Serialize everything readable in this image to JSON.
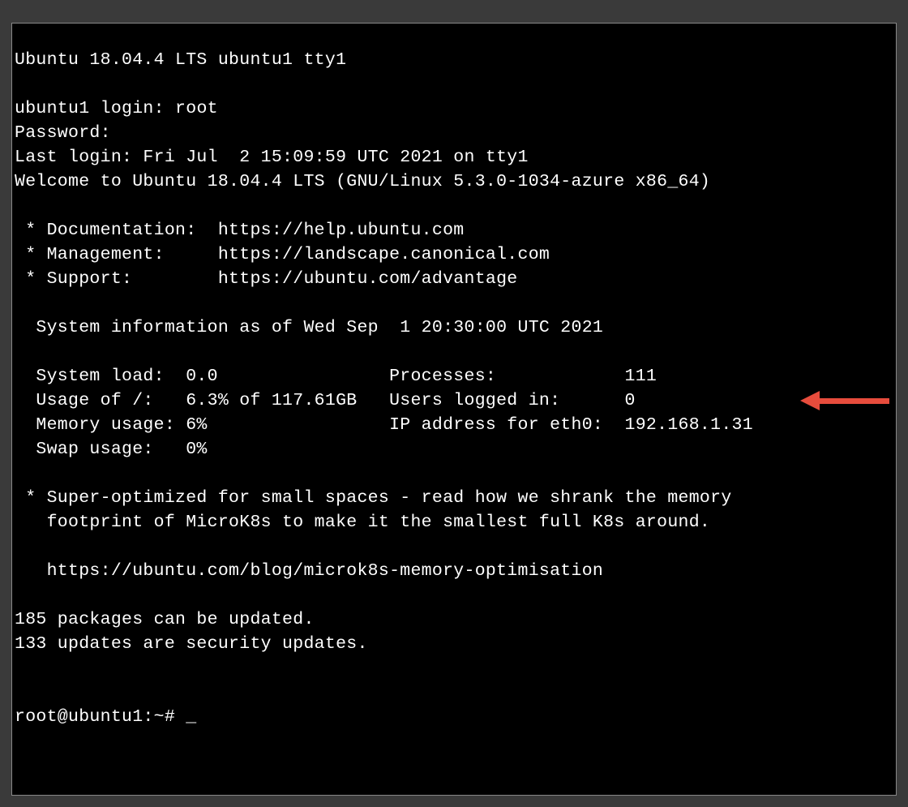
{
  "banner": "Ubuntu 18.04.4 LTS ubuntu1 tty1",
  "login_prompt": "ubuntu1 login: ",
  "login_user": "root",
  "password_prompt": "Password:",
  "last_login": "Last login: Fri Jul  2 15:09:59 UTC 2021 on tty1",
  "welcome": "Welcome to Ubuntu 18.04.4 LTS (GNU/Linux 5.3.0-1034-azure x86_64)",
  "links": {
    "doc_label": " * Documentation:  ",
    "doc_url": "https://help.ubuntu.com",
    "mgmt_label": " * Management:     ",
    "mgmt_url": "https://landscape.canonical.com",
    "support_label": " * Support:        ",
    "support_url": "https://ubuntu.com/advantage"
  },
  "sysinfo_header": "  System information as of Wed Sep  1 20:30:00 UTC 2021",
  "stats": {
    "line1": "  System load:  0.0                Processes:            111",
    "line2": "  Usage of /:   6.3% of 117.61GB   Users logged in:      0",
    "line3": "  Memory usage: 6%                 IP address for eth0:  192.168.1.31",
    "line4": "  Swap usage:   0%",
    "system_load": "0.0",
    "processes": "111",
    "usage_of_root": "6.3% of 117.61GB",
    "users_logged_in": "0",
    "memory_usage": "6%",
    "ip_eth0": "192.168.1.31",
    "swap_usage": "0%"
  },
  "promo": {
    "line1": " * Super-optimized for small spaces - read how we shrank the memory",
    "line2": "   footprint of MicroK8s to make it the smallest full K8s around.",
    "url": "   https://ubuntu.com/blog/microk8s-memory-optimisation"
  },
  "updates": {
    "packages": "185 packages can be updated.",
    "security": "133 updates are security updates."
  },
  "prompt": "root@ubuntu1:~# ",
  "cursor": "_"
}
